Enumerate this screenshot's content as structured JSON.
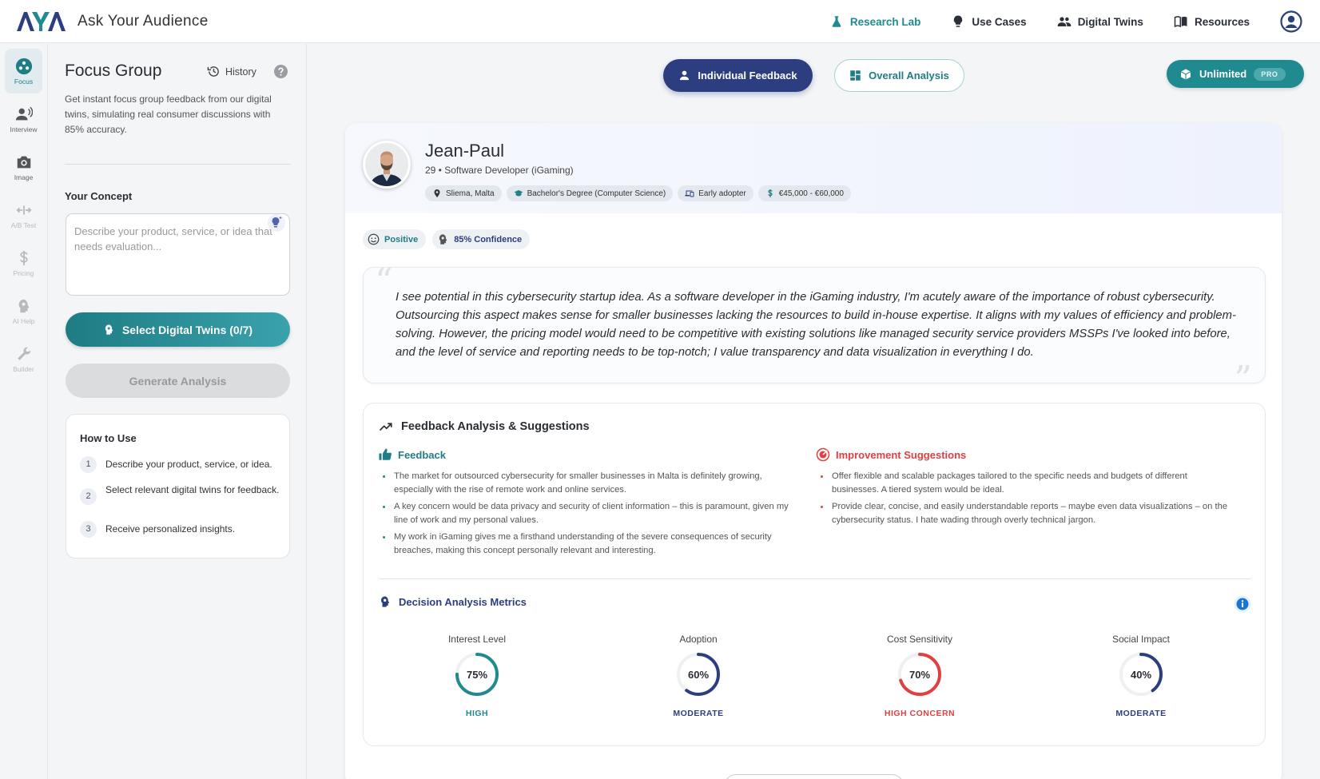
{
  "header": {
    "logo_text": "AYA",
    "app_title": "Ask Your Audience",
    "nav": [
      {
        "label": "Research Lab",
        "icon": "flask-icon",
        "active": true
      },
      {
        "label": "Use Cases",
        "icon": "lightbulb-icon",
        "active": false
      },
      {
        "label": "Digital Twins",
        "icon": "people-icon",
        "active": false
      },
      {
        "label": "Resources",
        "icon": "book-icon",
        "active": false
      }
    ]
  },
  "rail": [
    {
      "label": "Focus",
      "active": true
    },
    {
      "label": "Interview",
      "active": false
    },
    {
      "label": "Image",
      "active": false
    },
    {
      "label": "A/B Test",
      "active": false,
      "disabled": true
    },
    {
      "label": "Pricing",
      "active": false,
      "disabled": true
    },
    {
      "label": "AI Help",
      "active": false,
      "disabled": true
    },
    {
      "label": "Builder",
      "active": false,
      "disabled": true
    }
  ],
  "panel": {
    "title": "Focus Group",
    "history_label": "History",
    "description": "Get instant focus group feedback from our digital twins, simulating real consumer discussions with 85% accuracy.",
    "concept_label": "Your Concept",
    "concept_placeholder": "Describe your product, service, or idea that needs evaluation...",
    "select_button": "Select Digital Twins (0/7)",
    "generate_button": "Generate Analysis",
    "how_to": {
      "title": "How to Use",
      "steps": [
        {
          "num": "1",
          "text": "Describe your product, service, or idea."
        },
        {
          "num": "2",
          "text": "Select relevant digital twins for feedback."
        },
        {
          "num": "3",
          "text": "Receive personalized insights."
        }
      ]
    }
  },
  "main": {
    "toggle_individual": "Individual Feedback",
    "toggle_overall": "Overall Analysis",
    "plan_label": "Unlimited",
    "plan_badge": "PRO",
    "persona": {
      "name": "Jean-Paul",
      "subtitle": "29 • Software Developer (iGaming)",
      "tags": [
        {
          "label": "Sliema, Malta",
          "icon": "location-pin-icon"
        },
        {
          "label": "Bachelor's Degree (Computer Science)",
          "icon": "graduation-cap-icon"
        },
        {
          "label": "Early adopter",
          "icon": "devices-icon"
        },
        {
          "label": "€45,000 - €60,000",
          "icon": "dollar-icon"
        }
      ]
    },
    "sentiment": "Positive",
    "confidence": "85% Confidence",
    "quote": "I see potential in this cybersecurity startup idea. As a software developer in the iGaming industry, I'm acutely aware of the importance of robust cybersecurity. Outsourcing this aspect makes sense for smaller businesses lacking the resources to build in-house expertise. It aligns with my values of efficiency and problem-solving. However, the pricing model would need to be competitive with existing solutions like managed security service providers MSSPs I've looked into before, and the level of service and reporting needs to be top-notch; I value transparency and data visualization in everything I do.",
    "analysis": {
      "title": "Feedback Analysis & Suggestions",
      "feedback_title": "Feedback",
      "feedback": [
        "The market for outsourced cybersecurity for smaller businesses in Malta is definitely growing, especially with the rise of remote work and online services.",
        "A key concern would be data privacy and security of client information – this is paramount, given my line of work and my personal values.",
        "My work in iGaming gives me a firsthand understanding of the severe consequences of security breaches, making this concept personally relevant and interesting."
      ],
      "improvement_title": "Improvement Suggestions",
      "improvements": [
        "Offer flexible and scalable packages tailored to the specific needs and budgets of different businesses. A tiered system would be ideal.",
        "Provide clear, concise, and easily understandable reports – maybe even data visualizations – on the cybersecurity status. I hate wading through overly technical jargon."
      ],
      "metrics_title": "Decision Analysis Metrics",
      "metrics": [
        {
          "label": "Interest Level",
          "value": 75,
          "display": "75%",
          "level": "HIGH",
          "color": "#1f8a8f"
        },
        {
          "label": "Adoption",
          "value": 60,
          "display": "60%",
          "level": "MODERATE",
          "color": "#2c3e80"
        },
        {
          "label": "Cost Sensitivity",
          "value": 70,
          "display": "70%",
          "level": "HIGH CONCERN",
          "color": "#e14040"
        },
        {
          "label": "Social Impact",
          "value": 40,
          "display": "40%",
          "level": "MODERATE",
          "color": "#2c3e80"
        }
      ]
    }
  }
}
